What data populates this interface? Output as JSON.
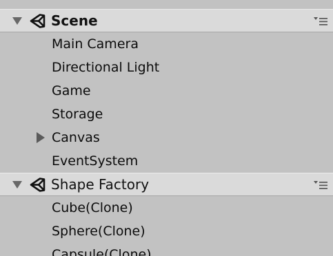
{
  "icons": {
    "scene_icon": "unity-logo-icon",
    "foldout_expanded": "triangle-down-icon",
    "foldout_collapsed": "triangle-right-icon",
    "options": "context-menu-icon"
  },
  "colors": {
    "panel_background": "#c2c2c2",
    "scene_header_background": "#dadada",
    "text": "#000000",
    "foldout_arrow": "#666666"
  },
  "hierarchy": {
    "scenes": [
      {
        "name": "Scene",
        "active": true,
        "expanded": true,
        "objects": [
          {
            "name": "Main Camera",
            "has_children": false
          },
          {
            "name": "Directional Light",
            "has_children": false
          },
          {
            "name": "Game",
            "has_children": false
          },
          {
            "name": "Storage",
            "has_children": false
          },
          {
            "name": "Canvas",
            "has_children": true,
            "expanded": false
          },
          {
            "name": "EventSystem",
            "has_children": false
          }
        ]
      },
      {
        "name": "Shape Factory",
        "active": false,
        "expanded": true,
        "objects": [
          {
            "name": "Cube(Clone)",
            "has_children": false
          },
          {
            "name": "Sphere(Clone)",
            "has_children": false
          },
          {
            "name": "Capsule(Clone)",
            "has_children": false
          }
        ]
      }
    ]
  }
}
